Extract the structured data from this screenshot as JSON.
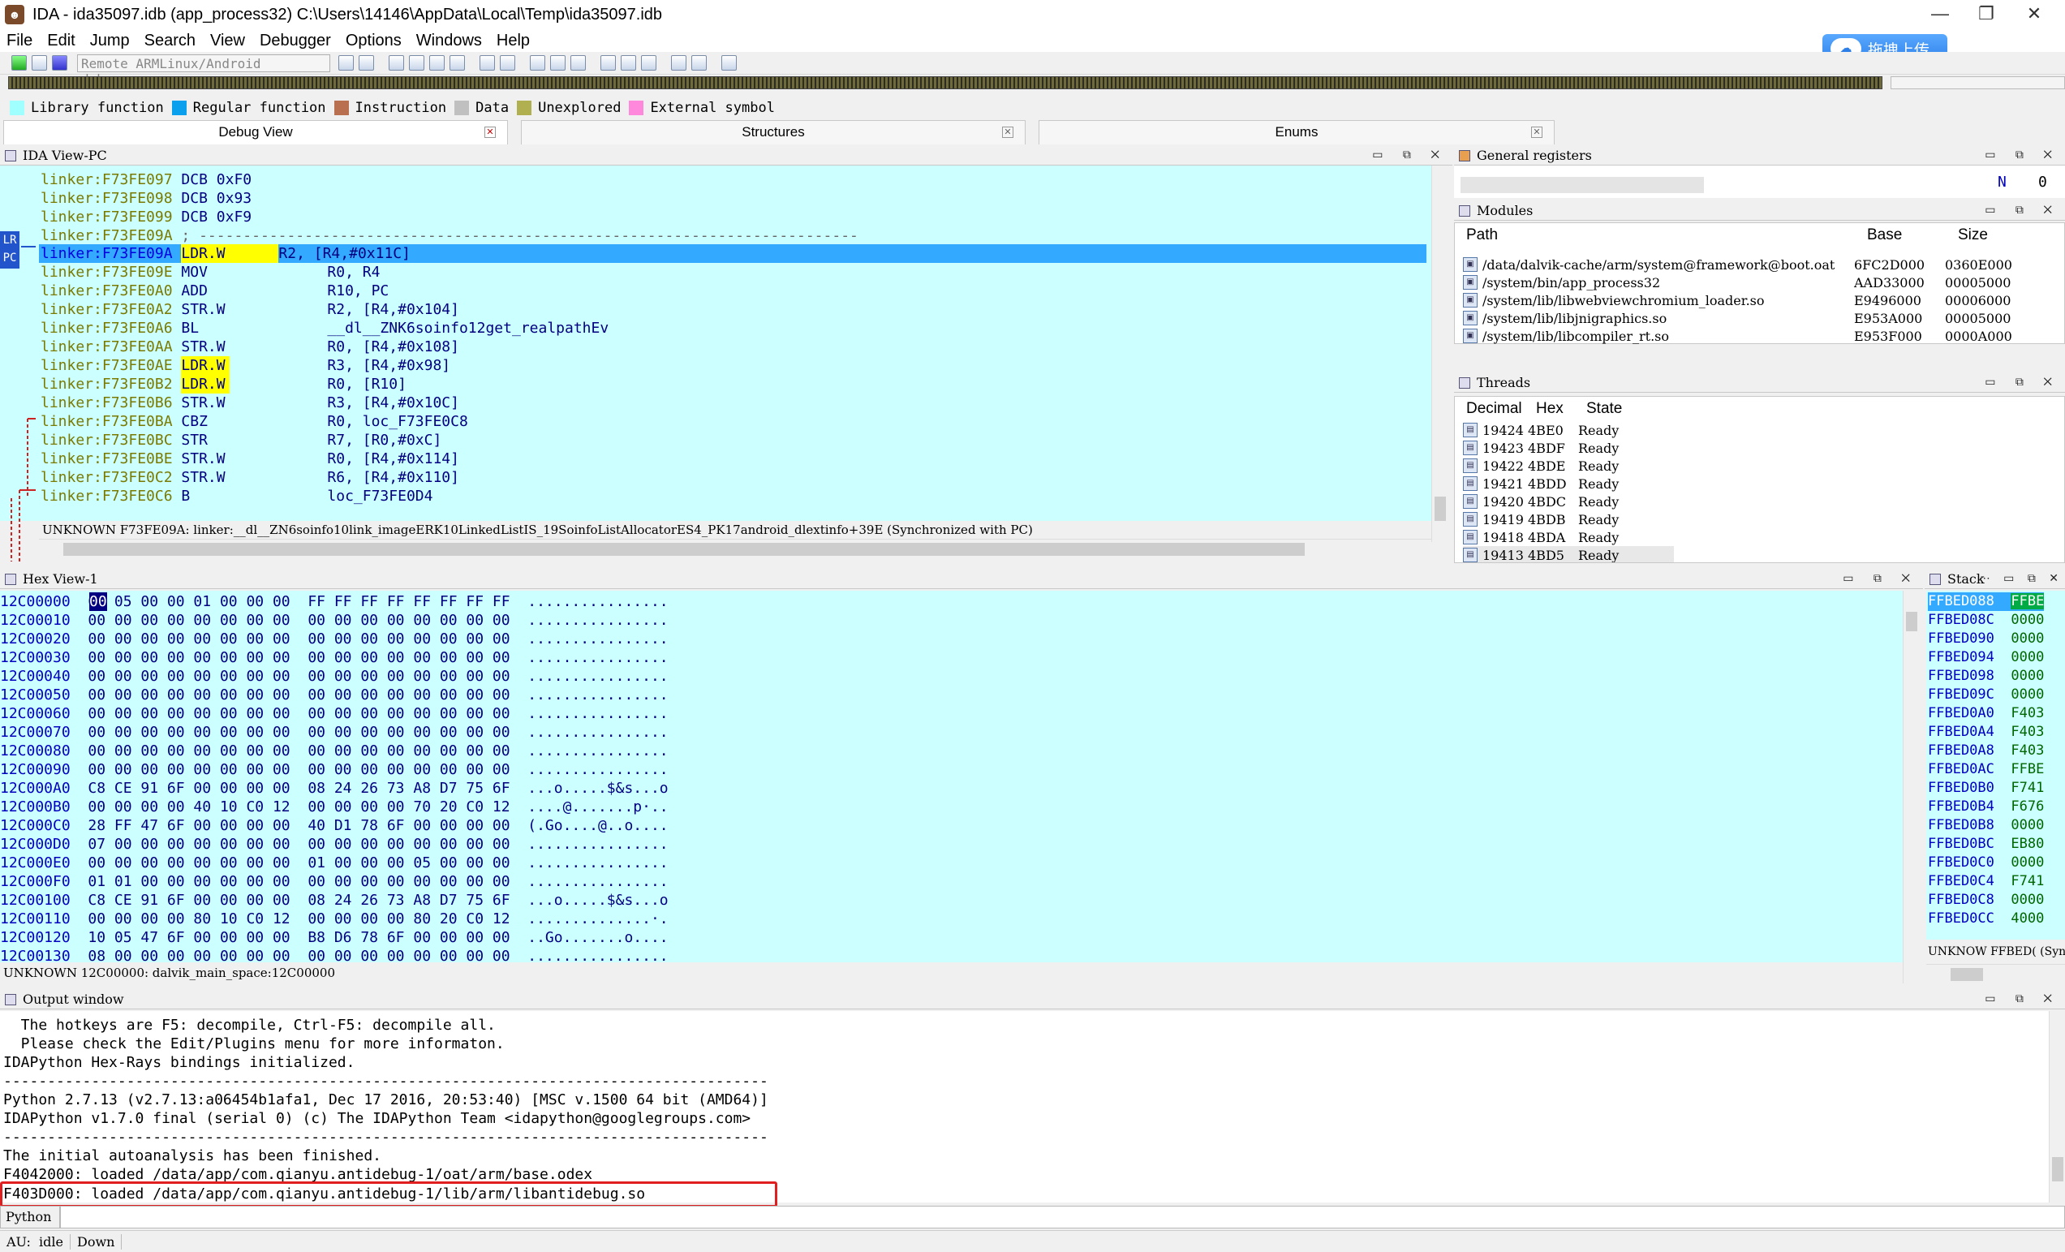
{
  "window": {
    "title": "IDA - ida35097.idb (app_process32) C:\\Users\\14146\\AppData\\Local\\Temp\\ida35097.idb"
  },
  "menu": [
    "File",
    "Edit",
    "Jump",
    "Search",
    "View",
    "Debugger",
    "Options",
    "Windows",
    "Help"
  ],
  "toolbar": {
    "debugger_select": "Remote ARMLinux/Android debugger"
  },
  "upload_button": {
    "label": "拖拽上传"
  },
  "legend": [
    {
      "label": "Library function",
      "color": "#a0ffff"
    },
    {
      "label": "Regular function",
      "color": "#0aa0ee"
    },
    {
      "label": "Instruction",
      "color": "#b87050"
    },
    {
      "label": "Data",
      "color": "#c0c0c0"
    },
    {
      "label": "Unexplored",
      "color": "#b0b050"
    },
    {
      "label": "External symbol",
      "color": "#ff88dd"
    }
  ],
  "tabs": [
    {
      "label": "Debug View"
    },
    {
      "label": "Structures"
    },
    {
      "label": "Enums"
    }
  ],
  "ida_view": {
    "title": "IDA View-PC",
    "markers": {
      "lr": "LR",
      "pc": "PC"
    },
    "lines": [
      {
        "addr": "linker:F73FE097",
        "mn": "DCB",
        "op": "0xF0"
      },
      {
        "addr": "linker:F73FE098",
        "mn": "DCB",
        "op": "0x93"
      },
      {
        "addr": "linker:F73FE099",
        "mn": "DCB",
        "op": "0xF9"
      },
      {
        "addr": "linker:F73FE09A",
        "mn": ";",
        "op": "---------------------------------------------------------------------------"
      },
      {
        "addr": "linker:F73FE09A",
        "mn": "LDR.W",
        "op": "R2, [R4,#0x11C]"
      },
      {
        "addr": "linker:F73FE09E",
        "mn": "MOV",
        "op": "R0, R4"
      },
      {
        "addr": "linker:F73FE0A0",
        "mn": "ADD",
        "op": "R10, PC"
      },
      {
        "addr": "linker:F73FE0A2",
        "mn": "STR.W",
        "op": "R2, [R4,#0x104]"
      },
      {
        "addr": "linker:F73FE0A6",
        "mn": "BL",
        "op": "__dl__ZNK6soinfo12get_realpathEv"
      },
      {
        "addr": "linker:F73FE0AA",
        "mn": "STR.W",
        "op": "R0, [R4,#0x108]"
      },
      {
        "addr": "linker:F73FE0AE",
        "mn": "LDR.W",
        "op": "R3, [R4,#0x98]"
      },
      {
        "addr": "linker:F73FE0B2",
        "mn": "LDR.W",
        "op": "R0, [R10]"
      },
      {
        "addr": "linker:F73FE0B6",
        "mn": "STR.W",
        "op": "R3, [R4,#0x10C]"
      },
      {
        "addr": "linker:F73FE0BA",
        "mn": "CBZ",
        "op": "R0, loc_F73FE0C8"
      },
      {
        "addr": "linker:F73FE0BC",
        "mn": "STR",
        "op": "R7, [R0,#0xC]"
      },
      {
        "addr": "linker:F73FE0BE",
        "mn": "STR.W",
        "op": "R0, [R4,#0x114]"
      },
      {
        "addr": "linker:F73FE0C2",
        "mn": "STR.W",
        "op": "R6, [R4,#0x110]"
      },
      {
        "addr": "linker:F73FE0C6",
        "mn": "B",
        "op": "loc_F73FE0D4"
      }
    ],
    "status": "UNKNOWN F73FE09A: linker:__dl__ZN6soinfo10link_imageERK10LinkedListIS_19SoinfoListAllocatorES4_PK17android_dlextinfo+39E (Synchronized with PC)"
  },
  "registers": {
    "title": "General registers",
    "flag": "N",
    "flag_value": "0"
  },
  "modules": {
    "title": "Modules",
    "columns": [
      "Path",
      "Base",
      "Size"
    ],
    "rows": [
      [
        "/data/dalvik-cache/arm/system@framework@boot.oat",
        "6FC2D000",
        "0360E000"
      ],
      [
        "/system/bin/app_process32",
        "AAD33000",
        "00005000"
      ],
      [
        "/system/lib/libwebviewchromium_loader.so",
        "E9496000",
        "00006000"
      ],
      [
        "/system/lib/libjnigraphics.so",
        "E953A000",
        "00005000"
      ],
      [
        "/system/lib/libcompiler_rt.so",
        "E953F000",
        "0000A000"
      ]
    ]
  },
  "threads": {
    "title": "Threads",
    "columns": [
      "Decimal",
      "Hex",
      "State"
    ],
    "rows": [
      [
        "19424",
        "4BE0",
        "Ready"
      ],
      [
        "19423",
        "4BDF",
        "Ready"
      ],
      [
        "19422",
        "4BDE",
        "Ready"
      ],
      [
        "19421",
        "4BDD",
        "Ready"
      ],
      [
        "19420",
        "4BDC",
        "Ready"
      ],
      [
        "19419",
        "4BDB",
        "Ready"
      ],
      [
        "19418",
        "4BDA",
        "Ready"
      ],
      [
        "19413",
        "4BD5",
        "Ready"
      ]
    ]
  },
  "hex_view": {
    "title": "Hex View-1",
    "lines": [
      {
        "addr": "12C00000",
        "bytes": "00 05 00 00 01 00 00 00  FF FF FF FF FF FF FF FF",
        "ascii": "................"
      },
      {
        "addr": "12C00010",
        "bytes": "00 00 00 00 00 00 00 00  00 00 00 00 00 00 00 00",
        "ascii": "................"
      },
      {
        "addr": "12C00020",
        "bytes": "00 00 00 00 00 00 00 00  00 00 00 00 00 00 00 00",
        "ascii": "................"
      },
      {
        "addr": "12C00030",
        "bytes": "00 00 00 00 00 00 00 00  00 00 00 00 00 00 00 00",
        "ascii": "................"
      },
      {
        "addr": "12C00040",
        "bytes": "00 00 00 00 00 00 00 00  00 00 00 00 00 00 00 00",
        "ascii": "................"
      },
      {
        "addr": "12C00050",
        "bytes": "00 00 00 00 00 00 00 00  00 00 00 00 00 00 00 00",
        "ascii": "................"
      },
      {
        "addr": "12C00060",
        "bytes": "00 00 00 00 00 00 00 00  00 00 00 00 00 00 00 00",
        "ascii": "................"
      },
      {
        "addr": "12C00070",
        "bytes": "00 00 00 00 00 00 00 00  00 00 00 00 00 00 00 00",
        "ascii": "................"
      },
      {
        "addr": "12C00080",
        "bytes": "00 00 00 00 00 00 00 00  00 00 00 00 00 00 00 00",
        "ascii": "................"
      },
      {
        "addr": "12C00090",
        "bytes": "00 00 00 00 00 00 00 00  00 00 00 00 00 00 00 00",
        "ascii": "................"
      },
      {
        "addr": "12C000A0",
        "bytes": "C8 CE 91 6F 00 00 00 00  08 24 26 73 A8 D7 75 6F",
        "ascii": "...o.....$&s...o"
      },
      {
        "addr": "12C000B0",
        "bytes": "00 00 00 00 40 10 C0 12  00 00 00 00 70 20 C0 12",
        "ascii": "....@.......p·.."
      },
      {
        "addr": "12C000C0",
        "bytes": "28 FF 47 6F 00 00 00 00  40 D1 78 6F 00 00 00 00",
        "ascii": "(.Go....@..o...."
      },
      {
        "addr": "12C000D0",
        "bytes": "07 00 00 00 00 00 00 00  00 00 00 00 00 00 00 00",
        "ascii": "................"
      },
      {
        "addr": "12C000E0",
        "bytes": "00 00 00 00 00 00 00 00  01 00 00 00 05 00 00 00",
        "ascii": "................"
      },
      {
        "addr": "12C000F0",
        "bytes": "01 01 00 00 00 00 00 00  00 00 00 00 00 00 00 00",
        "ascii": "................"
      },
      {
        "addr": "12C00100",
        "bytes": "C8 CE 91 6F 00 00 00 00  08 24 26 73 A8 D7 75 6F",
        "ascii": "...o.....$&s...o"
      },
      {
        "addr": "12C00110",
        "bytes": "00 00 00 00 80 10 C0 12  00 00 00 00 80 20 C0 12",
        "ascii": "..............·."
      },
      {
        "addr": "12C00120",
        "bytes": "10 05 47 6F 00 00 00 00  B8 D6 78 6F 00 00 00 00",
        "ascii": "..Go.......o...."
      },
      {
        "addr": "12C00130",
        "bytes": "08 00 00 00 00 00 00 00  00 00 00 00 00 00 00 00",
        "ascii": "................"
      }
    ],
    "status": "UNKNOWN 12C00000: dalvik_main_space:12C00000"
  },
  "stack": {
    "title": "Stack",
    "rows": [
      [
        "FFBED088",
        "FFBE"
      ],
      [
        "FFBED08C",
        "0000"
      ],
      [
        "FFBED090",
        "0000"
      ],
      [
        "FFBED094",
        "0000"
      ],
      [
        "FFBED098",
        "0000"
      ],
      [
        "FFBED09C",
        "0000"
      ],
      [
        "FFBED0A0",
        "F403"
      ],
      [
        "FFBED0A4",
        "F403"
      ],
      [
        "FFBED0A8",
        "F403"
      ],
      [
        "FFBED0AC",
        "FFBE"
      ],
      [
        "FFBED0B0",
        "F741"
      ],
      [
        "FFBED0B4",
        "F676"
      ],
      [
        "FFBED0B8",
        "0000"
      ],
      [
        "FFBED0BC",
        "EB80"
      ],
      [
        "FFBED0C0",
        "0000"
      ],
      [
        "FFBED0C4",
        "F741"
      ],
      [
        "FFBED0C8",
        "0000"
      ],
      [
        "FFBED0CC",
        "4000"
      ]
    ],
    "status": "UNKNOW FFBED( (Sync"
  },
  "output": {
    "title": "Output window",
    "lines": [
      "  The hotkeys are F5: decompile, Ctrl-F5: decompile all.",
      "  Please check the Edit/Plugins menu for more informaton.",
      "IDAPython Hex-Rays bindings initialized.",
      "---------------------------------------------------------------------------------------",
      "Python 2.7.13 (v2.7.13:a06454b1afa1, Dec 17 2016, 20:53:40) [MSC v.1500 64 bit (AMD64)]",
      "IDAPython v1.7.0 final (serial 0) (c) The IDAPython Team <idapython@googlegroups.com>",
      "---------------------------------------------------------------------------------------",
      "The initial autoanalysis has been finished.",
      "F4042000: loaded /data/app/com.qianyu.antidebug-1/oat/arm/base.odex",
      "F403D000: loaded /data/app/com.qianyu.antidebug-1/lib/arm/libantidebug.so"
    ],
    "input_tab": "Python"
  },
  "statusbar": {
    "au_label": "AU:",
    "au_value": "idle",
    "direction": "Down"
  }
}
